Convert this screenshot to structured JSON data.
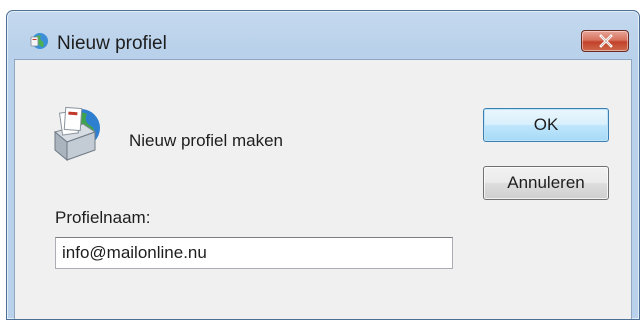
{
  "window": {
    "title": "Nieuw profiel",
    "title_icon": "mail-globe-icon",
    "close_icon": "close-x-icon"
  },
  "header": {
    "icon": "new-profile-mailbox-icon",
    "text": "Nieuw profiel maken"
  },
  "form": {
    "name_label": "Profielnaam:",
    "name_value": "info@mailonline.nu"
  },
  "buttons": {
    "ok_label": "OK",
    "cancel_label": "Annuleren"
  },
  "colors": {
    "frame": "#b9d1ea",
    "client": "#f0f0f0",
    "default_button": "#bee6fd",
    "close_button": "#c2412a"
  }
}
